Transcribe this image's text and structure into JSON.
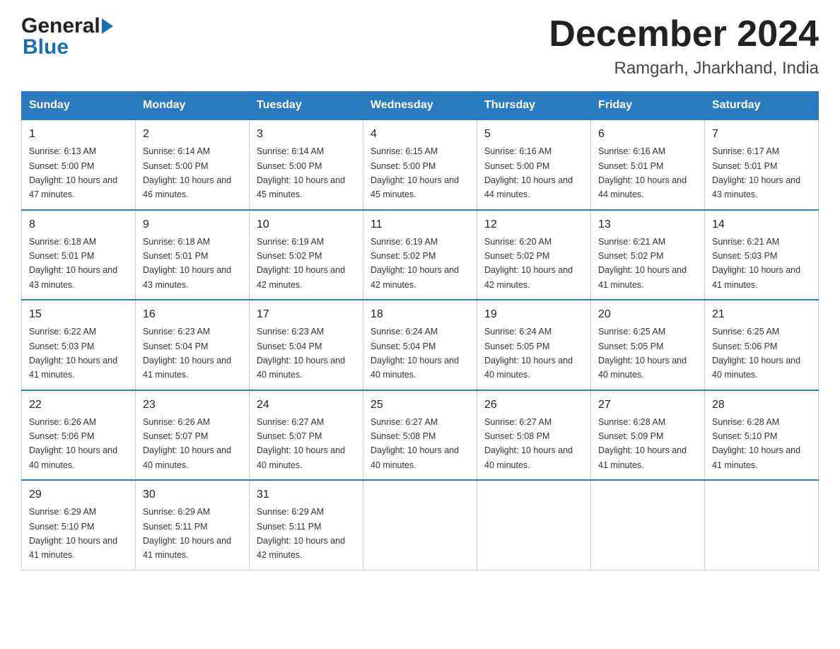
{
  "header": {
    "logo_general": "General",
    "logo_blue": "Blue",
    "title": "December 2024",
    "subtitle": "Ramgarh, Jharkhand, India"
  },
  "days_of_week": [
    "Sunday",
    "Monday",
    "Tuesday",
    "Wednesday",
    "Thursday",
    "Friday",
    "Saturday"
  ],
  "weeks": [
    [
      {
        "day": "1",
        "sunrise": "6:13 AM",
        "sunset": "5:00 PM",
        "daylight": "10 hours and 47 minutes."
      },
      {
        "day": "2",
        "sunrise": "6:14 AM",
        "sunset": "5:00 PM",
        "daylight": "10 hours and 46 minutes."
      },
      {
        "day": "3",
        "sunrise": "6:14 AM",
        "sunset": "5:00 PM",
        "daylight": "10 hours and 45 minutes."
      },
      {
        "day": "4",
        "sunrise": "6:15 AM",
        "sunset": "5:00 PM",
        "daylight": "10 hours and 45 minutes."
      },
      {
        "day": "5",
        "sunrise": "6:16 AM",
        "sunset": "5:00 PM",
        "daylight": "10 hours and 44 minutes."
      },
      {
        "day": "6",
        "sunrise": "6:16 AM",
        "sunset": "5:01 PM",
        "daylight": "10 hours and 44 minutes."
      },
      {
        "day": "7",
        "sunrise": "6:17 AM",
        "sunset": "5:01 PM",
        "daylight": "10 hours and 43 minutes."
      }
    ],
    [
      {
        "day": "8",
        "sunrise": "6:18 AM",
        "sunset": "5:01 PM",
        "daylight": "10 hours and 43 minutes."
      },
      {
        "day": "9",
        "sunrise": "6:18 AM",
        "sunset": "5:01 PM",
        "daylight": "10 hours and 43 minutes."
      },
      {
        "day": "10",
        "sunrise": "6:19 AM",
        "sunset": "5:02 PM",
        "daylight": "10 hours and 42 minutes."
      },
      {
        "day": "11",
        "sunrise": "6:19 AM",
        "sunset": "5:02 PM",
        "daylight": "10 hours and 42 minutes."
      },
      {
        "day": "12",
        "sunrise": "6:20 AM",
        "sunset": "5:02 PM",
        "daylight": "10 hours and 42 minutes."
      },
      {
        "day": "13",
        "sunrise": "6:21 AM",
        "sunset": "5:02 PM",
        "daylight": "10 hours and 41 minutes."
      },
      {
        "day": "14",
        "sunrise": "6:21 AM",
        "sunset": "5:03 PM",
        "daylight": "10 hours and 41 minutes."
      }
    ],
    [
      {
        "day": "15",
        "sunrise": "6:22 AM",
        "sunset": "5:03 PM",
        "daylight": "10 hours and 41 minutes."
      },
      {
        "day": "16",
        "sunrise": "6:23 AM",
        "sunset": "5:04 PM",
        "daylight": "10 hours and 41 minutes."
      },
      {
        "day": "17",
        "sunrise": "6:23 AM",
        "sunset": "5:04 PM",
        "daylight": "10 hours and 40 minutes."
      },
      {
        "day": "18",
        "sunrise": "6:24 AM",
        "sunset": "5:04 PM",
        "daylight": "10 hours and 40 minutes."
      },
      {
        "day": "19",
        "sunrise": "6:24 AM",
        "sunset": "5:05 PM",
        "daylight": "10 hours and 40 minutes."
      },
      {
        "day": "20",
        "sunrise": "6:25 AM",
        "sunset": "5:05 PM",
        "daylight": "10 hours and 40 minutes."
      },
      {
        "day": "21",
        "sunrise": "6:25 AM",
        "sunset": "5:06 PM",
        "daylight": "10 hours and 40 minutes."
      }
    ],
    [
      {
        "day": "22",
        "sunrise": "6:26 AM",
        "sunset": "5:06 PM",
        "daylight": "10 hours and 40 minutes."
      },
      {
        "day": "23",
        "sunrise": "6:26 AM",
        "sunset": "5:07 PM",
        "daylight": "10 hours and 40 minutes."
      },
      {
        "day": "24",
        "sunrise": "6:27 AM",
        "sunset": "5:07 PM",
        "daylight": "10 hours and 40 minutes."
      },
      {
        "day": "25",
        "sunrise": "6:27 AM",
        "sunset": "5:08 PM",
        "daylight": "10 hours and 40 minutes."
      },
      {
        "day": "26",
        "sunrise": "6:27 AM",
        "sunset": "5:08 PM",
        "daylight": "10 hours and 40 minutes."
      },
      {
        "day": "27",
        "sunrise": "6:28 AM",
        "sunset": "5:09 PM",
        "daylight": "10 hours and 41 minutes."
      },
      {
        "day": "28",
        "sunrise": "6:28 AM",
        "sunset": "5:10 PM",
        "daylight": "10 hours and 41 minutes."
      }
    ],
    [
      {
        "day": "29",
        "sunrise": "6:29 AM",
        "sunset": "5:10 PM",
        "daylight": "10 hours and 41 minutes."
      },
      {
        "day": "30",
        "sunrise": "6:29 AM",
        "sunset": "5:11 PM",
        "daylight": "10 hours and 41 minutes."
      },
      {
        "day": "31",
        "sunrise": "6:29 AM",
        "sunset": "5:11 PM",
        "daylight": "10 hours and 42 minutes."
      },
      null,
      null,
      null,
      null
    ]
  ]
}
